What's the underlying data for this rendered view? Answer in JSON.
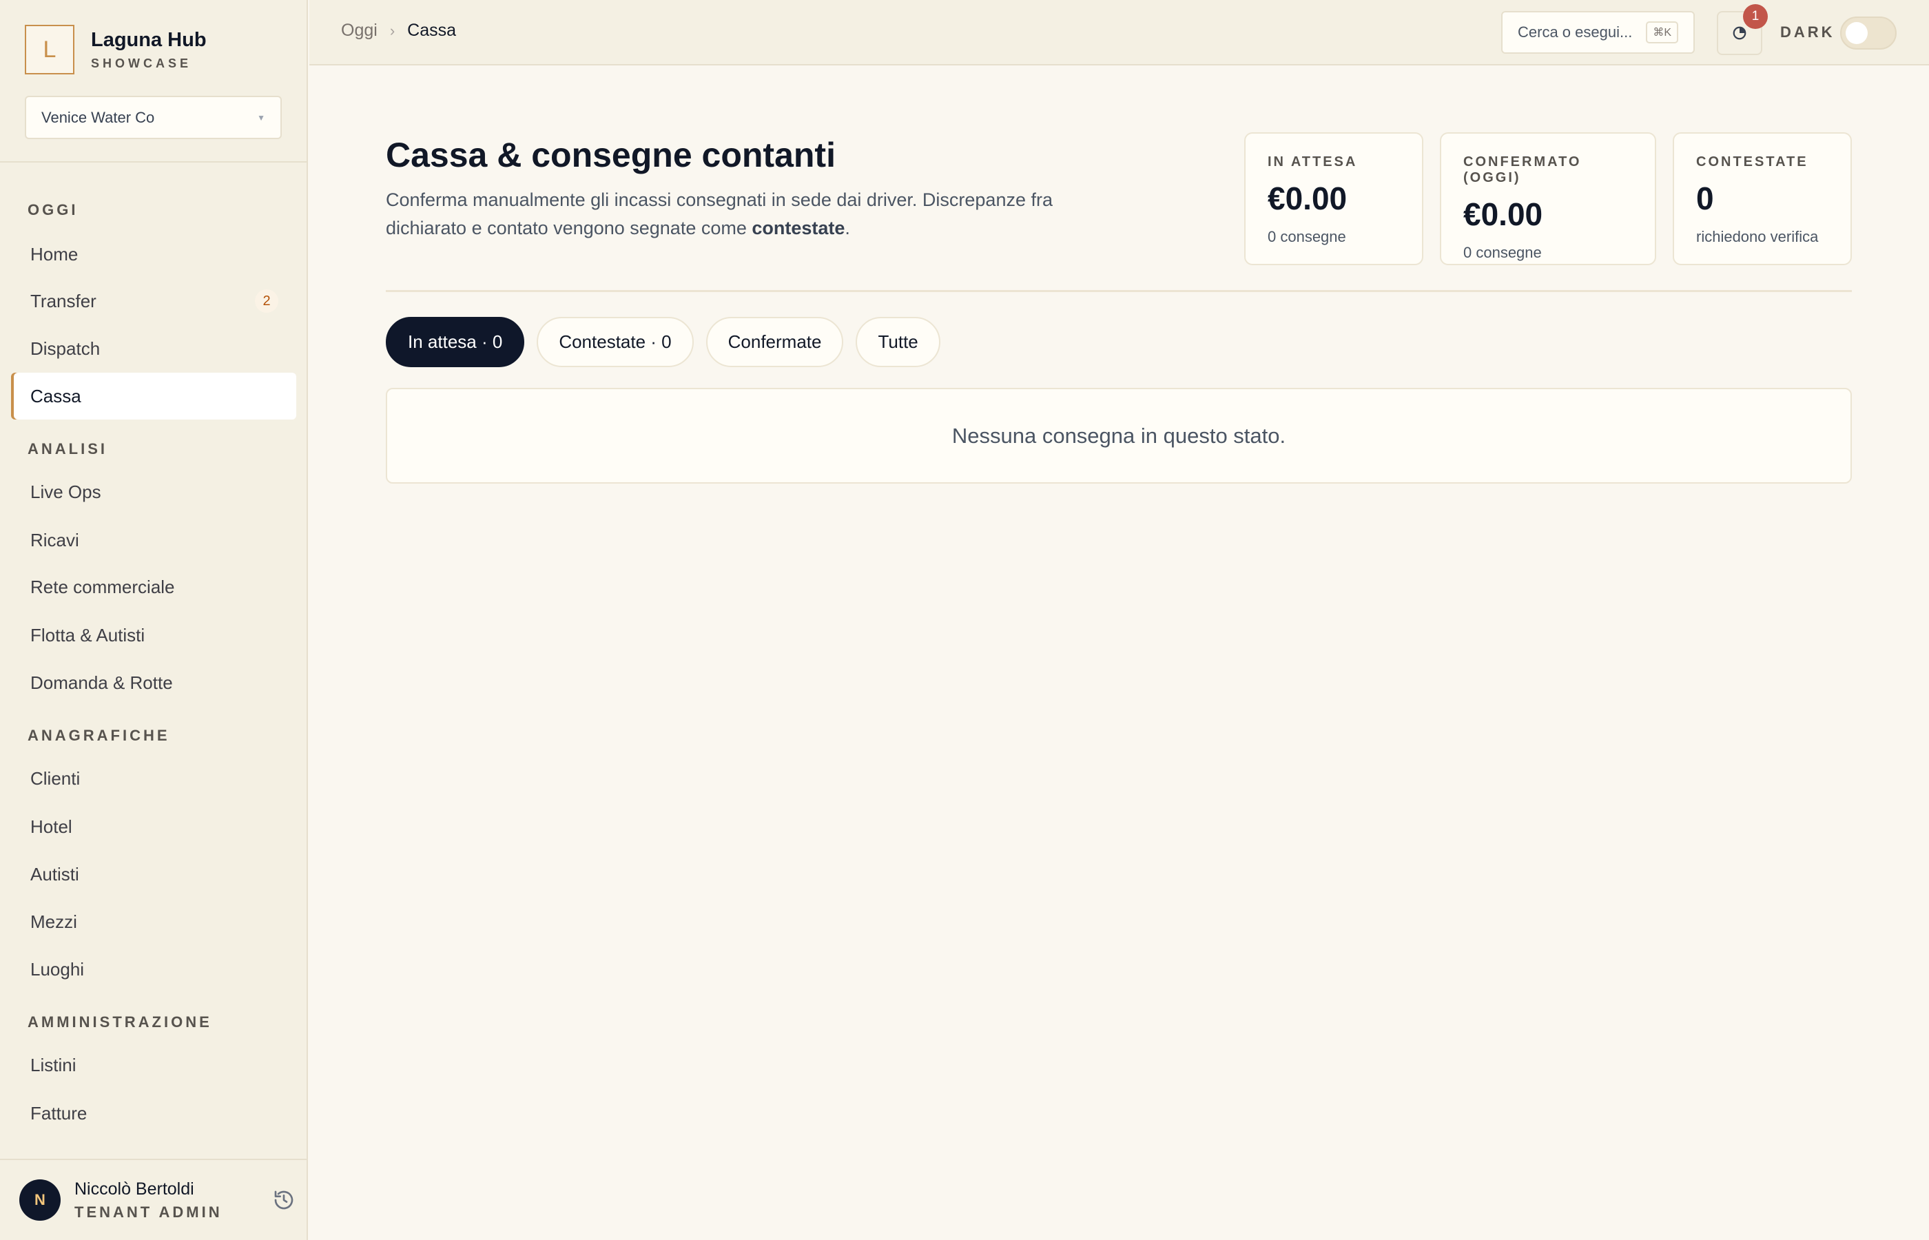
{
  "app": {
    "name": "Laguna Hub",
    "subtitle": "SHOWCASE",
    "logo_letter": "L",
    "accent_color": "#c88f4b"
  },
  "tenant": {
    "selected": "Venice Water Co"
  },
  "sidebar": {
    "sections": [
      {
        "title": "OGGI",
        "items": [
          {
            "label": "Home"
          },
          {
            "label": "Transfer",
            "badge": "2"
          },
          {
            "label": "Dispatch"
          },
          {
            "label": "Cassa",
            "active": true
          }
        ]
      },
      {
        "title": "ANALISI",
        "items": [
          {
            "label": "Live Ops"
          },
          {
            "label": "Ricavi"
          },
          {
            "label": "Rete commerciale"
          },
          {
            "label": "Flotta & Autisti"
          },
          {
            "label": "Domanda & Rotte"
          }
        ]
      },
      {
        "title": "ANAGRAFICHE",
        "items": [
          {
            "label": "Clienti"
          },
          {
            "label": "Hotel"
          },
          {
            "label": "Autisti"
          },
          {
            "label": "Mezzi"
          },
          {
            "label": "Luoghi"
          }
        ]
      },
      {
        "title": "AMMINISTRAZIONE",
        "items": [
          {
            "label": "Listini"
          },
          {
            "label": "Fatture"
          }
        ]
      }
    ]
  },
  "user": {
    "initial": "N",
    "name": "Niccolò Bertoldi",
    "role": "TENANT ADMIN"
  },
  "topbar": {
    "breadcrumb_parent": "Oggi",
    "breadcrumb_sep": "›",
    "breadcrumb_current": "Cassa",
    "search_placeholder": "Cerca o esegui...",
    "search_shortcut": "⌘K",
    "notification_count": "1",
    "dark_label": "DARK"
  },
  "page": {
    "title": "Cassa & consegne contanti",
    "description_before": "Conferma manualmente gli incassi consegnati in sede dai driver. Discrepanze fra dichiarato e contato vengono segnate come ",
    "description_bold": "contestate",
    "description_after": "."
  },
  "stats": [
    {
      "label": "IN ATTESA",
      "value": "€0.00",
      "sub": "0 consegne"
    },
    {
      "label": "CONFERMATO (OGGI)",
      "value": "€0.00",
      "sub": "0 consegne"
    },
    {
      "label": "CONTESTATE",
      "value": "0",
      "sub": "richiedono verifica"
    }
  ],
  "tabs": [
    {
      "label": "In attesa · 0",
      "active": true
    },
    {
      "label": "Contestate · 0"
    },
    {
      "label": "Confermate"
    },
    {
      "label": "Tutte"
    }
  ],
  "empty_state": "Nessuna consegna in questo stato."
}
